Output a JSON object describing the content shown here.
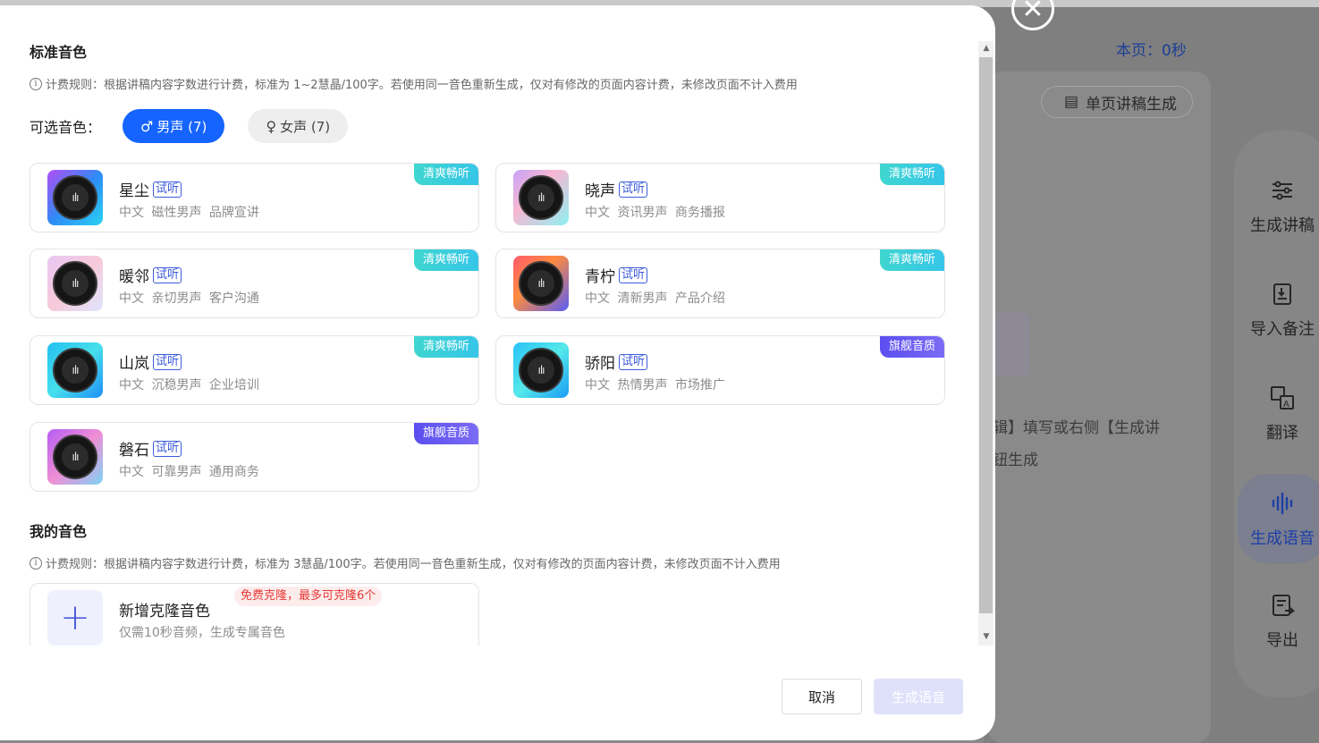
{
  "background": {
    "timer": "本页：0秒",
    "single_page_button": "单页讲稿生成",
    "hint_line1": "辑】填写或右侧【生成讲",
    "hint_line2": "钮生成",
    "sidebar": [
      {
        "label": "生成讲稿",
        "icon": "sliders-icon"
      },
      {
        "label": "导入备注",
        "icon": "import-note-icon"
      },
      {
        "label": "翻译",
        "icon": "translate-icon"
      },
      {
        "label": "生成语音",
        "icon": "voice-wave-icon",
        "active": true
      },
      {
        "label": "导出",
        "icon": "export-icon"
      }
    ]
  },
  "modal": {
    "standard": {
      "title": "标准音色",
      "rule": "计费规则：根据讲稿内容字数进行计费，标准为 1~2慧晶/100字。若使用同一音色重新生成，仅对有修改的页面内容计费，未修改页面不计入费用",
      "gender_label": "可选音色：",
      "male_tab": "男声 (7)",
      "female_tab": "女声 (7)",
      "voices": [
        {
          "name": "星尘",
          "try": "试听",
          "tags": "中文 磁性男声 品牌宣讲",
          "badge": "清爽畅听",
          "badge_color": "cyan"
        },
        {
          "name": "晓声",
          "try": "试听",
          "tags": "中文 资讯男声 商务播报",
          "badge": "清爽畅听",
          "badge_color": "cyan"
        },
        {
          "name": "暖邻",
          "try": "试听",
          "tags": "中文 亲切男声 客户沟通",
          "badge": "清爽畅听",
          "badge_color": "cyan"
        },
        {
          "name": "青柠",
          "try": "试听",
          "tags": "中文 清新男声 产品介绍",
          "badge": "清爽畅听",
          "badge_color": "cyan"
        },
        {
          "name": "山岚",
          "try": "试听",
          "tags": "中文 沉稳男声 企业培训",
          "badge": "清爽畅听",
          "badge_color": "cyan"
        },
        {
          "name": "骄阳",
          "try": "试听",
          "tags": "中文 热情男声 市场推广",
          "badge": "旗舰音质",
          "badge_color": "purple"
        },
        {
          "name": "磐石",
          "try": "试听",
          "tags": "中文 可靠男声 通用商务",
          "badge": "旗舰音质",
          "badge_color": "purple"
        }
      ]
    },
    "mine": {
      "title": "我的音色",
      "rule": "计费规则：根据讲稿内容字数进行计费，标准为 3慧晶/100字。若使用同一音色重新生成，仅对有修改的页面内容计费，未修改页面不计入费用",
      "add_title": "新增克隆音色",
      "add_badge": "免费克隆，最多可克隆6个",
      "add_desc": "仅需10秒音频，生成专属音色"
    },
    "cancel_label": "取消",
    "generate_label": "生成语音"
  }
}
